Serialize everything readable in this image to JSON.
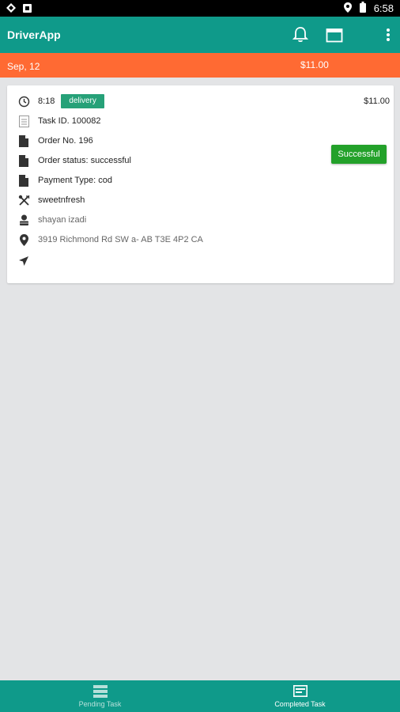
{
  "status_bar": {
    "time": "6:58"
  },
  "app_bar": {
    "title": "DriverApp",
    "icons": [
      "bell-icon",
      "calendar-icon",
      "more-vert-icon"
    ]
  },
  "date_bar": {
    "date": "Sep, 12",
    "total": "$11.00"
  },
  "task": {
    "time": "8:18",
    "type_badge": "delivery",
    "price": "$11.00",
    "task_id": "Task ID. 100082",
    "order_no": "Order No. 196",
    "order_status": "Order status: successful",
    "payment_type": "Payment Type: cod",
    "restaurant": "sweetnfresh",
    "customer": "shayan izadi",
    "address": "3919 Richmond Rd SW a- AB T3E 4P2 CA",
    "status_button": "Successful"
  },
  "bottom_nav": {
    "pending_label": "Pending Task",
    "completed_label": "Completed Task",
    "active": "completed"
  },
  "colors": {
    "primary": "#0f9a8a",
    "accent": "#ff6a33",
    "success": "#23a12a",
    "badge": "#26a178"
  }
}
